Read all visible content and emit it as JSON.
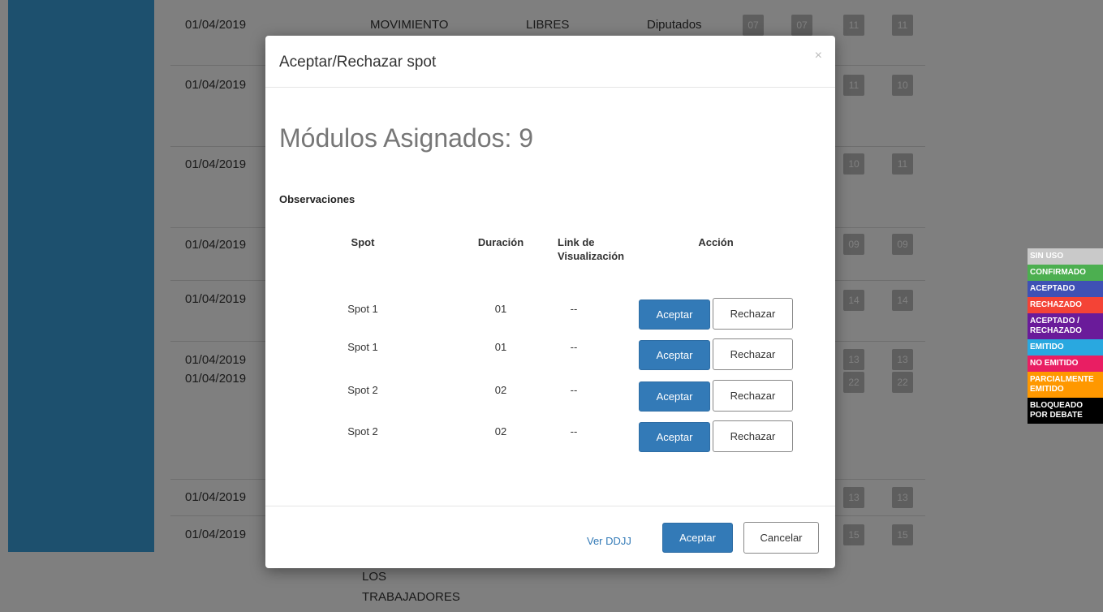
{
  "background": {
    "rows": [
      {
        "date": "01/04/2019",
        "col1": "MOVIMIENTO",
        "col2": "LIBRES",
        "col3": "Diputados",
        "badges": [
          "07",
          "07",
          "11",
          "11"
        ]
      },
      {
        "date": "01/04/2019",
        "badges": [
          "11",
          "10"
        ]
      },
      {
        "date": "01/04/2019",
        "badges": [
          "10",
          "11"
        ]
      },
      {
        "date": "01/04/2019",
        "badges": [
          "09",
          "09"
        ]
      },
      {
        "date": "01/04/2019",
        "badges": [
          "14",
          "14"
        ]
      },
      {
        "date": "01/04/2019",
        "badges": [
          "13",
          "13"
        ]
      },
      {
        "date": "01/04/2019",
        "badges": [
          "22",
          "22"
        ]
      },
      {
        "date": "01/04/2019",
        "badges": [
          "13",
          "13"
        ]
      },
      {
        "date": "01/04/2019",
        "badges": [
          "15",
          "15"
        ]
      }
    ],
    "bottom_text": [
      "LOS",
      "TRABAJADORES"
    ]
  },
  "legend": [
    {
      "label": "SIN USO",
      "color": "#c9c9c9"
    },
    {
      "label": "CONFIRMADO",
      "color": "#4caf50"
    },
    {
      "label": "ACEPTADO",
      "color": "#3f51b5"
    },
    {
      "label": "RECHAZADO",
      "color": "#f44336"
    },
    {
      "label": "ACEPTADO / RECHAZADO",
      "color": "#6a1b9a"
    },
    {
      "label": "EMITIDO",
      "color": "#29a8e0"
    },
    {
      "label": "NO EMITIDO",
      "color": "#e91e63"
    },
    {
      "label": "PARCIALMENTE EMITIDO",
      "color": "#ff9800"
    },
    {
      "label": "BLOQUEADO POR DEBATE",
      "color": "#000000"
    }
  ],
  "modal": {
    "title": "Aceptar/Rechazar spot",
    "close": "×",
    "modulos": "Módulos Asignados: 9",
    "observaciones": "Observaciones",
    "headers": {
      "spot": "Spot",
      "duracion": "Duración",
      "link": "Link de Visualización",
      "accion": "Acción"
    },
    "rows": [
      {
        "spot": "Spot 1",
        "duracion": "01",
        "link": "--"
      },
      {
        "spot": "Spot 1",
        "duracion": "01",
        "link": "--"
      },
      {
        "spot": "Spot 2",
        "duracion": "02",
        "link": "--"
      },
      {
        "spot": "Spot 2",
        "duracion": "02",
        "link": "--"
      }
    ],
    "row_accept": "Aceptar",
    "row_reject": "Rechazar",
    "footer": {
      "ver_ddjj": "Ver DDJJ",
      "accept": "Aceptar",
      "cancel": "Cancelar"
    }
  }
}
